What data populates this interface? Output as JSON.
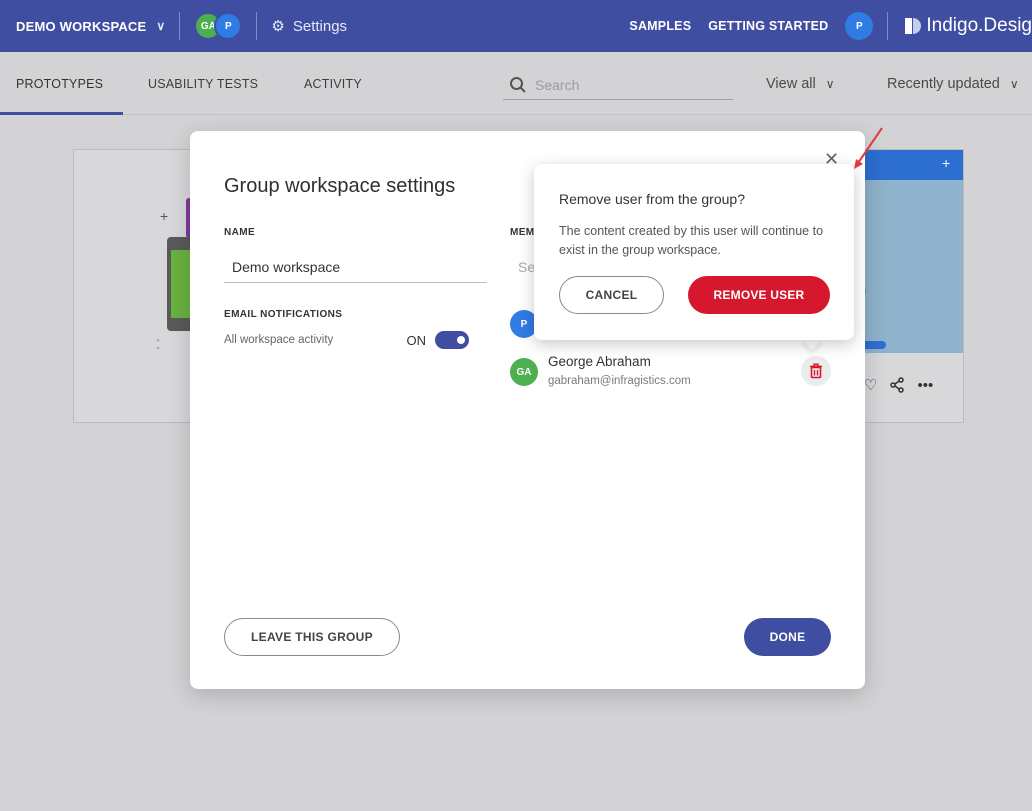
{
  "topbar": {
    "workspace_label": "DEMO WORKSPACE",
    "avatars": [
      "GA",
      "P"
    ],
    "settings_label": "Settings",
    "samples_label": "SAMPLES",
    "getting_started_label": "GETTING STARTED",
    "user_avatar": "P",
    "brand": "Indigo.Desig"
  },
  "subnav": {
    "tabs": [
      {
        "label": "PROTOTYPES",
        "active": true
      },
      {
        "label": "USABILITY TESTS",
        "active": false
      },
      {
        "label": "ACTIVITY",
        "active": false
      }
    ],
    "search_placeholder": "Search",
    "view_filter": "View all",
    "sort_filter": "Recently updated"
  },
  "modal": {
    "title": "Group workspace settings",
    "name_label": "NAME",
    "name_value": "Demo workspace",
    "email_notifications_label": "EMAIL NOTIFICATIONS",
    "activity_label": "All workspace activity",
    "toggle_state": "ON",
    "members_label": "MEM",
    "members_search_placeholder": "Se",
    "members": [
      {
        "initials": "P",
        "name": "",
        "email": "",
        "avatar_color": "#2f7ce5"
      },
      {
        "initials": "GA",
        "name": "George Abraham",
        "email": "gabraham@infragistics.com",
        "avatar_color": "#4caf50"
      }
    ],
    "leave_label": "LEAVE THIS GROUP",
    "done_label": "DONE"
  },
  "popover": {
    "title": "Remove user from the group?",
    "body": "The content created by this user will continue to exist in the group workspace.",
    "cancel_label": "CANCEL",
    "remove_label": "REMOVE USER"
  },
  "colors": {
    "brand": "#3f4ea0",
    "danger": "#d6182e",
    "avatar_green": "#4caf50",
    "avatar_blue": "#2f7ce5"
  }
}
